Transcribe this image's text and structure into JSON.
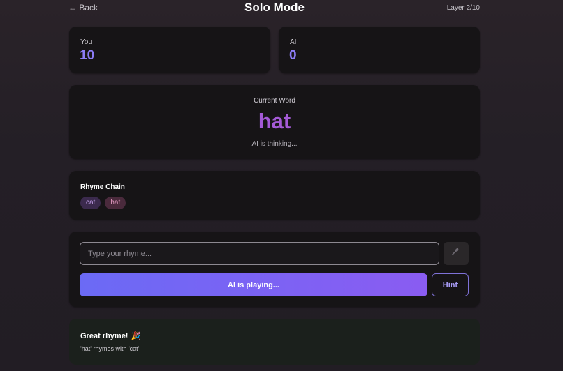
{
  "header": {
    "back_label": "← Back",
    "title": "Solo Mode",
    "layer": "Layer 2/10"
  },
  "scores": {
    "you": {
      "label": "You",
      "value": "10"
    },
    "ai": {
      "label": "AI",
      "value": "0"
    }
  },
  "current_word": {
    "label": "Current Word",
    "word": "hat",
    "status": "AI is thinking..."
  },
  "rhyme_chain": {
    "heading": "Rhyme Chain",
    "words": [
      "cat",
      "hat"
    ]
  },
  "input_panel": {
    "placeholder": "Type your rhyme...",
    "value": "",
    "mic_icon": "microphone-icon",
    "play_label": "AI is playing...",
    "hint_label": "Hint"
  },
  "feedback": {
    "title": "Great rhyme!",
    "emoji": "🎉",
    "message": "'hat' rhymes with 'cat'"
  },
  "colors": {
    "accent_purple": "#8c7cf6",
    "word_purple": "#a45ad6",
    "button_gradient_start": "#6b6af5",
    "button_gradient_end": "#8a5cf2"
  }
}
